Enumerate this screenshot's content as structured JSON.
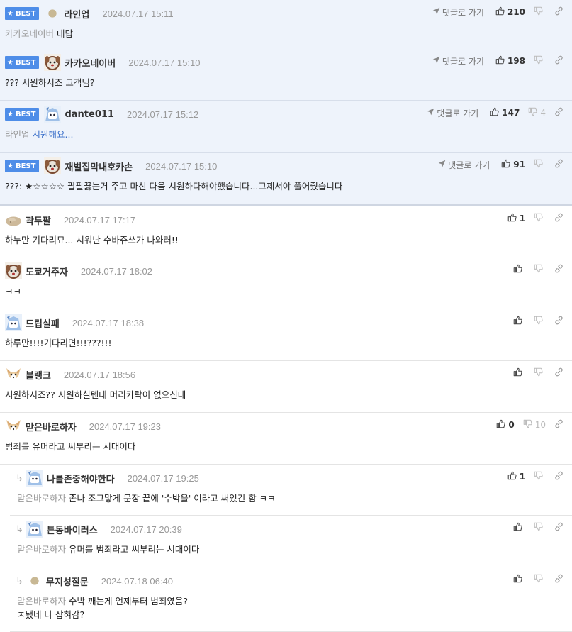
{
  "ui": {
    "best_label": "BEST",
    "reply_label": "댓글로 가기"
  },
  "colors": {
    "best_bg": "#eef3fb",
    "badge": "#4e8de8",
    "link": "#3a6fc9"
  },
  "best_comments": [
    {
      "nick": "라인업",
      "date": "2024.07.17 15:11",
      "ref": "카카오네이버",
      "text": "대답",
      "likes": "210",
      "dislikes": "",
      "avatar": "beige-circle-avatar"
    },
    {
      "nick": "카카오네이버",
      "date": "2024.07.17 15:10",
      "ref": "",
      "text": "??? 시원하시죠 고객님?",
      "likes": "198",
      "dislikes": "",
      "avatar": "dog-face-avatar"
    },
    {
      "nick": "dante011",
      "date": "2024.07.17 15:12",
      "ref": "라인업",
      "text": "시원해요...",
      "likes": "147",
      "dislikes": "4",
      "avatar": "blue-character-avatar"
    },
    {
      "nick": "재벌집막내호카손",
      "date": "2024.07.17 15:10",
      "ref": "",
      "text": "???: ★☆☆☆☆ 팔팔끓는거 주고 마신 다음 시원하다해야했습니다...그제서야 풀어줬습니다",
      "likes": "91",
      "dislikes": "",
      "avatar": "dog-face-avatar"
    }
  ],
  "comments": [
    {
      "nick": "곽두팔",
      "date": "2024.07.17 17:17",
      "ref": "",
      "text": "하누만 기다리묘... 시워난 수바쥬쓰가 나와러!!",
      "likes": "1",
      "dislikes": "",
      "avatar": "rock-avatar"
    },
    {
      "nick": "도쿄거주자",
      "date": "2024.07.17 18:02",
      "ref": "",
      "text": "ㅋㅋ",
      "likes": "",
      "dislikes": "",
      "avatar": "dog-face-avatar"
    },
    {
      "nick": "드립실패",
      "date": "2024.07.17 18:38",
      "ref": "",
      "text": "하루만!!!!기다리면!!!???!!!",
      "likes": "",
      "dislikes": "",
      "avatar": "blue-character-avatar"
    },
    {
      "nick": "블랭크",
      "date": "2024.07.17 18:56",
      "ref": "",
      "text": "시원하시죠?? 시원하실텐데 머리카락이 없으신데",
      "likes": "",
      "dislikes": "",
      "avatar": "chihuahua-avatar"
    },
    {
      "nick": "맏은바로하자",
      "date": "2024.07.17 19:23",
      "ref": "",
      "text": "범죄를 유머라고 씨부리는 시대이다",
      "likes": "0",
      "dislikes": "10",
      "avatar": "chihuahua-avatar"
    }
  ],
  "replies": [
    {
      "nick": "나를존중해야한다",
      "date": "2024.07.17 19:25",
      "ref": "맏은바로하자",
      "text": "존나 조그맣게 문장 끝에 '수박을' 이라고 써있긴 함 ㅋㅋ",
      "likes": "1",
      "dislikes": "",
      "avatar": "blue-character-avatar"
    },
    {
      "nick": "튼동바이러스",
      "date": "2024.07.17 20:39",
      "ref": "맏은바로하자",
      "text": "유머를 범죄라고 씨부리는 시대이다",
      "likes": "",
      "dislikes": "",
      "avatar": "blue-character-avatar"
    },
    {
      "nick": "무지성질문",
      "date": "2024.07.18 06:40",
      "ref": "맏은바로하자",
      "text": "수박 깨는게 언제부터 범죄였음?",
      "text2": "ㅈ됐네 나 잡혀감?",
      "likes": "",
      "dislikes": "",
      "avatar": "beige-circle-avatar"
    }
  ]
}
